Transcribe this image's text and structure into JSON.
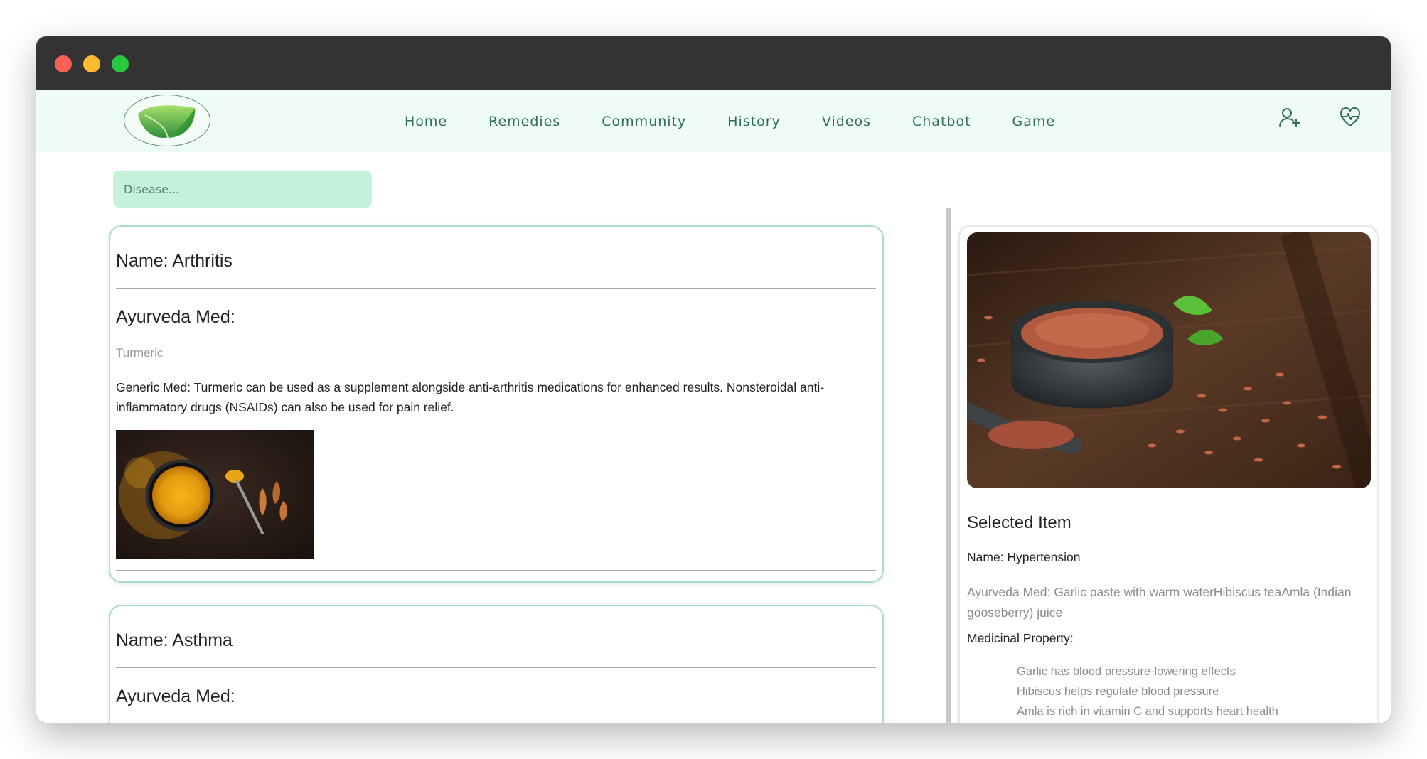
{
  "nav": {
    "links": [
      "Home",
      "Remedies",
      "Community",
      "History",
      "Videos",
      "Chatbot",
      "Game"
    ],
    "icons": [
      "user-plus-icon",
      "heart-pulse-icon"
    ]
  },
  "search": {
    "placeholder": "Disease..."
  },
  "cards": [
    {
      "name": "Name: Arthritis",
      "ayurveda_label": "Ayurveda Med:",
      "ayurveda_med": "Turmeric",
      "generic_med": "Generic Med: Turmeric can be used as a supplement alongside anti-arthritis medications for enhanced results. Nonsteroidal anti-inflammatory drugs (NSAIDs) can also be used for pain relief."
    },
    {
      "name": "Name: Asthma",
      "ayurveda_label": "Ayurveda Med:"
    }
  ],
  "selected": {
    "title": "Selected Item",
    "name": "Name: Hypertension",
    "ayurveda": "Ayurveda Med: Garlic paste with warm waterHibiscus teaAmla (Indian gooseberry) juice",
    "property_label": "Medicinal Property:",
    "properties": [
      "Garlic has blood pressure-lowering effects",
      "Hibiscus helps regulate blood pressure",
      "Amla is rich in vitamin C and supports heart health"
    ]
  },
  "colors": {
    "nav_bg": "#effbf8",
    "nav_text": "#2f6f4c",
    "search_bg": "#c6f1dd",
    "card_border": "#a9ddd0",
    "titlebar": "#333333"
  }
}
